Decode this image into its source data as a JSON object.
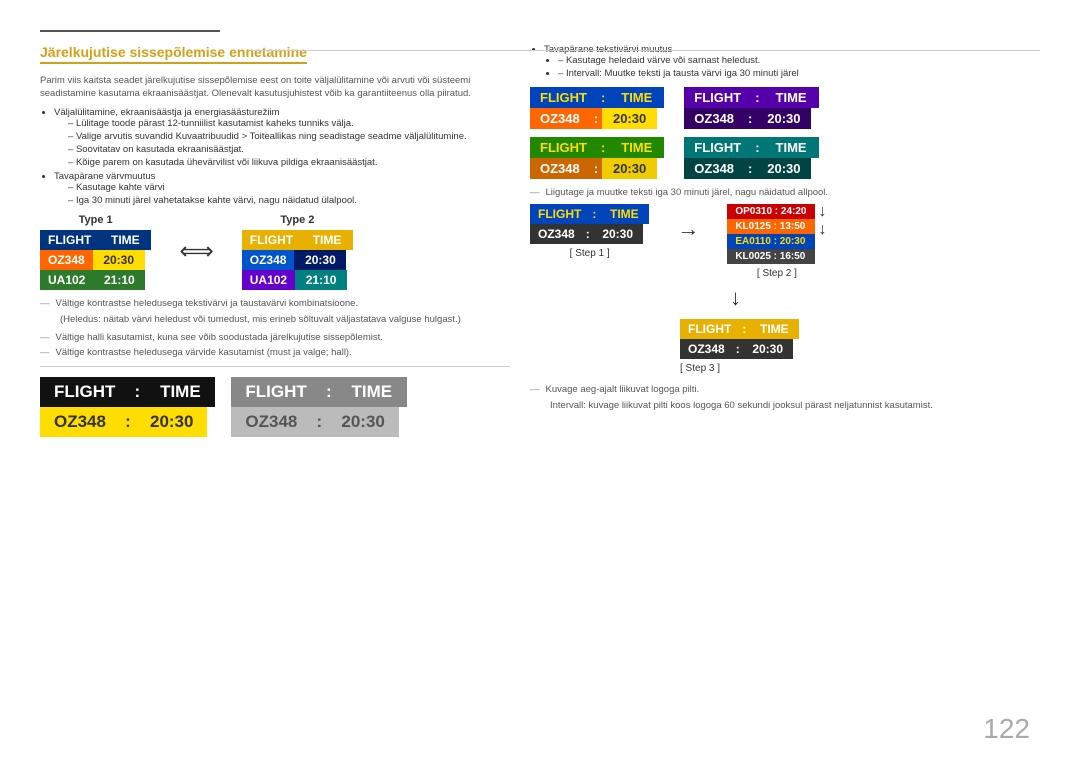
{
  "page": {
    "number": "122"
  },
  "header": {
    "title": "Järelkujutise sissepõlemise ennetamine",
    "intro": "Parim viis kaitsta seadet järelkujutise sissepõlemise eest on toite väljalülitamine või arvuti või süsteemi seadistamine kasutama ekraanisäästjat. Olenevalt kasutusjuhistest võib ka garantiiteenus olla piiratud.",
    "bullets": [
      {
        "text": "Väljalülitamine, ekraanisäästja ja energiasäästurežiim",
        "subs": [
          "Lülitage toode pärast 12-tunniilist kasutamist kaheks tunniks välja.",
          "Valige arvutis suvandid Kuvaatribuudid > Toiteallikas ning seadistage seadme väljalülitumine.",
          "Soovitatav on kasutada ekraanisäästjat.",
          "Kõige parem on kasutada ühevärvilist või liikuva pildiga ekraanisäästjat."
        ]
      },
      {
        "text": "Tavapärane värvmuutus",
        "subs": [
          "Kasutage kahte värvi",
          "Iga 30 minuti järel vahetatakse kahte värvi, nagu näidatud ülalpool."
        ]
      }
    ]
  },
  "type1_label": "Type 1",
  "type2_label": "Type 2",
  "boards": {
    "type1": {
      "header": [
        "FLIGHT",
        "TIME"
      ],
      "rows": [
        {
          "cells": [
            "OZ348",
            "20:30"
          ],
          "colors": [
            "orange",
            "yellow"
          ]
        },
        {
          "cells": [
            "UA102",
            "21:10"
          ],
          "colors": [
            "green",
            "green"
          ]
        }
      ]
    },
    "type2": {
      "header": [
        "FLIGHT",
        "TIME"
      ],
      "rows": [
        {
          "cells": [
            "OZ348",
            "20:30"
          ],
          "colors": [
            "blue",
            "darkblue"
          ]
        },
        {
          "cells": [
            "UA102",
            "21:10"
          ],
          "colors": [
            "purple",
            "teal"
          ]
        }
      ]
    }
  },
  "notes_left": [
    "Vältige kontrastse heledusega tekstivärvi ja taustavärvi kombinatsioone.",
    "(Heledus: näitab värvi heledust või tumedust, mis erineb sõltuvalt väljastatava valguse hulgast.)",
    "Vältige halli kasutamist, kuna see võib soodustada järelkujutise sissepõlemist.",
    "Vältige kontrastse heledusega värvide kasutamist (must ja valge; hall)."
  ],
  "big_boards": {
    "board1": {
      "bg": "dark",
      "header": [
        "FLIGHT",
        ":",
        "TIME"
      ],
      "rows": [
        [
          "OZ348",
          ":",
          "20:30"
        ]
      ]
    },
    "board2": {
      "bg": "gray",
      "header": [
        "FLIGHT",
        ":",
        "TIME"
      ],
      "rows": [
        [
          "OZ348",
          ":",
          "20:30"
        ]
      ]
    }
  },
  "right_col": {
    "note1": "Tavapärane tekstivärvi muutus",
    "note1_subs": [
      "Kasutage heledaid värve või sarnast heledust.",
      "Intervall: Muutke teksti ja tausta värvi iga 30 minuti järel"
    ],
    "boards_grid": [
      {
        "header_bg": "blue",
        "header": [
          "FLIGHT",
          ":",
          "TIME"
        ],
        "row_colors": [
          "orange",
          "yellow"
        ],
        "row": [
          "OZ348",
          ":",
          "20:30"
        ]
      },
      {
        "header_bg": "darkblue",
        "header": [
          "FLIGHT",
          ":",
          "TIME"
        ],
        "row_colors": [
          "purple2",
          "purple2"
        ],
        "row": [
          "OZ348",
          ":",
          "20:30"
        ]
      },
      {
        "header_bg": "green2",
        "header": [
          "FLIGHT",
          ":",
          "TIME"
        ],
        "row_colors": [
          "orange2",
          "yellow2"
        ],
        "row": [
          "OZ348",
          ":",
          "20:30"
        ]
      },
      {
        "header_bg": "teal2",
        "header": [
          "FLIGHT",
          ":",
          "TIME"
        ],
        "row_colors": [
          "teal2",
          "teal2"
        ],
        "row": [
          "OZ348",
          ":",
          "20:30"
        ]
      }
    ],
    "note2": "Liigutage ja muutke teksti iga 30 minuti järel, nagu näidatud allpool.",
    "step1_label": "[ Step 1 ]",
    "step2_label": "[ Step 2 ]",
    "step3_label": "[ Step 3 ]",
    "step1_board": {
      "header": [
        "FLIGHT",
        ":",
        "TIME"
      ],
      "row": [
        "OZ348",
        ":",
        "20:30"
      ]
    },
    "step2_boards": [
      "OP0310 : 24:20",
      "KL0125 : 13:50",
      "EA0110 : 20:30",
      "KL0025 : 16:50"
    ],
    "step3_board": {
      "header": [
        "FLIGHT",
        ":",
        "TIME"
      ],
      "row": [
        "OZ348",
        ":",
        "20:30"
      ]
    },
    "logo_note": "Kuvage aeg-ajalt liikuvat logoga pilti.",
    "logo_interval": "Intervall: kuvage liikuvat pilti koos logoga 60 sekundi jooksul pärast neljatunnist kasutamist."
  }
}
